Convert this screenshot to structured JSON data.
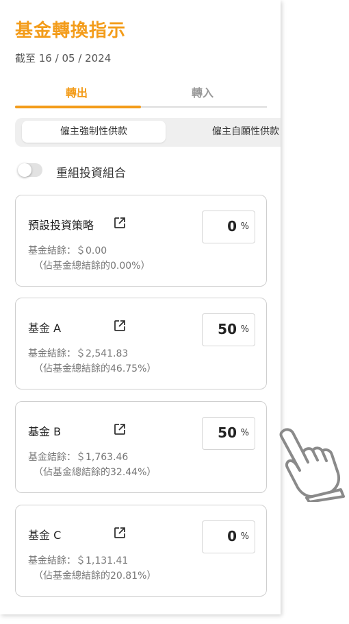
{
  "header": {
    "title": "基金轉換指示",
    "date": "截至 16 / 05 / 2024"
  },
  "tabs": [
    {
      "label": "轉出",
      "active": true
    },
    {
      "label": "轉入",
      "active": false
    }
  ],
  "segment": {
    "active_label": "僱主強制性供款",
    "other_label": "僱主自願性供款"
  },
  "toggle": {
    "label": "重組投資組合",
    "on": false
  },
  "funds": [
    {
      "name": "預設投資策略",
      "balance": "基金結餘：＄0.00",
      "pct_text": "（佔基金總結餘的0.00%）",
      "percent": "0",
      "sign": "%"
    },
    {
      "name": "基金 A",
      "balance": "基金結餘：＄2,541.83",
      "pct_text": "（佔基金總結餘的46.75%）",
      "percent": "50",
      "sign": "%"
    },
    {
      "name": "基金 B",
      "balance": "基金結餘：＄1,763.46",
      "pct_text": "（佔基金總結餘的32.44%）",
      "percent": "50",
      "sign": "%"
    },
    {
      "name": "基金 C",
      "balance": "基金結餘：＄1,131.41",
      "pct_text": "（佔基金總結餘的20.81%）",
      "percent": "0",
      "sign": "%"
    }
  ],
  "colors": {
    "accent": "#f39c1a",
    "border": "#cfcfcf"
  },
  "icons": [
    "external-link-icon",
    "pointer-hand-icon"
  ]
}
